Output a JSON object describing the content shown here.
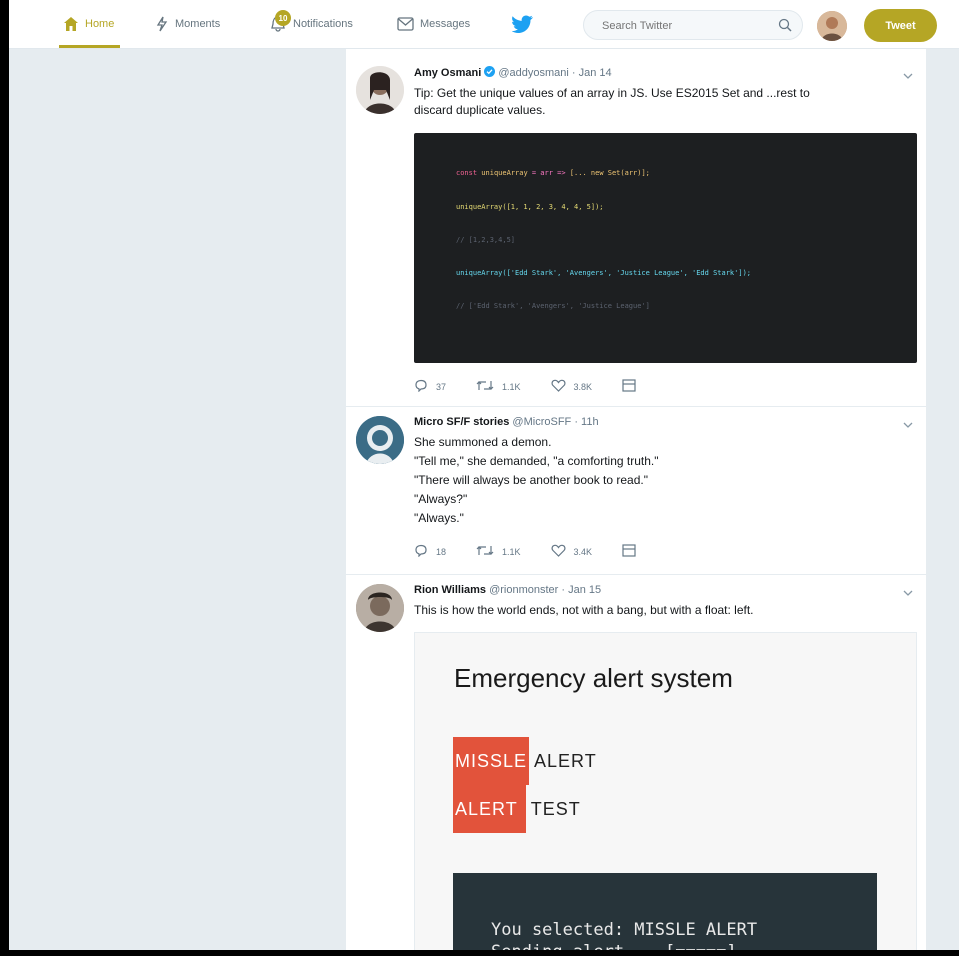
{
  "nav": {
    "items": [
      {
        "label": "Home",
        "icon": "home-icon",
        "active": true
      },
      {
        "label": "Moments",
        "icon": "lightning-icon",
        "active": false
      },
      {
        "label": "Notifications",
        "icon": "bell-icon",
        "active": false,
        "badge": "10"
      },
      {
        "label": "Messages",
        "icon": "envelope-icon",
        "active": false
      }
    ],
    "search_placeholder": "Search Twitter",
    "tweet_button": "Tweet",
    "accent": "#b5a625"
  },
  "tweets": [
    {
      "name": "Amy Osmani",
      "handle": "@addyosmani",
      "time": "Jan 14",
      "text_lines": [
        "Tip: Get the unique values of an array in JS. Use ES2015 Set and ...rest to",
        "discard duplicate values."
      ],
      "code_lines": [
        "const uniqueArray = arr => [...new Set(arr)];",
        "uniqueArray([1, 1, 2, 3, 4, 4, 5]);",
        "// [1,2,3,4,5]",
        "uniqueArray(['Edd Stark', 'Avengers', 'Justice League', 'Edd Stark']);",
        "// ['Edd Stark', 'Avengers', 'Justice League']"
      ],
      "replies": "37",
      "retweets": "1.1K",
      "likes": "3.8K"
    },
    {
      "name": "Micro SF/F stories",
      "handle": "@MicroSFF",
      "time": "11h",
      "text_lines": [
        "She summoned a demon.",
        "\"Tell me,\" she demanded, \"a comforting truth.\"",
        "\"There will always be another book to read.\"",
        "\"Always?\"",
        "\"Always.\""
      ],
      "replies": "18",
      "retweets": "1.1K",
      "likes": "3.4K"
    },
    {
      "name": "Rion Williams",
      "handle": "@rionmonster",
      "time": "Jan 15",
      "text_lines": [
        "This is how the world ends, not with a bang, but with a float: left."
      ],
      "card": {
        "title": "Emergency alert system",
        "row1_highlight": "MISSLE",
        "row1_plain": "ALERT",
        "row2_highlight": "ALERT",
        "row2_plain": "TEST",
        "terminal_lines": [
          "You selected: MISSLE ALERT",
          "Sending alert... [=====]"
        ]
      }
    }
  ]
}
